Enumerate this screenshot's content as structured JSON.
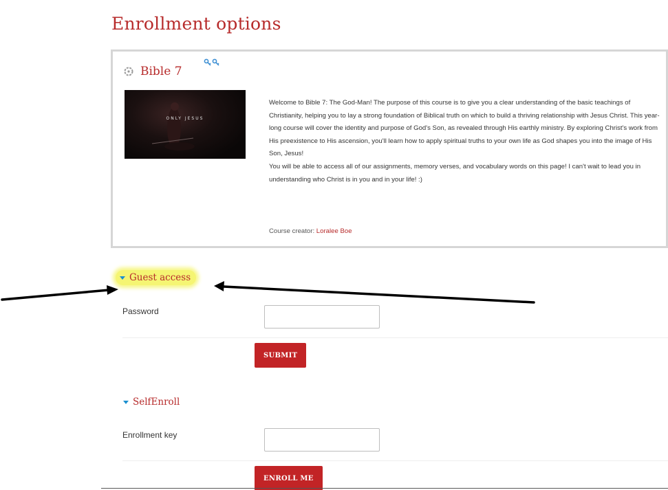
{
  "page": {
    "title": "Enrollment options"
  },
  "course": {
    "name": "Bible 7",
    "image_caption": "ONLY JESUS",
    "summary_paragraph_1": "Welcome to Bible 7: The God-Man!  The purpose of this course is to give you a clear understanding of the basic teachings of Christianity, helping you to lay a strong foundation of Biblical truth on which to build a thriving relationship with Jesus Christ.  This year-long course will cover the identity and purpose of God's Son, as revealed through His earthly ministry. By exploring Christ's work from His preexistence to His ascension, you'll learn how to apply spiritual truths to your own life as God shapes you into the image of His Son, Jesus!",
    "summary_paragraph_2": "You will be able to access all of our assignments, memory verses, and vocabulary words on this page! I can't wait to lead you in understanding who Christ is in you and in your life! :)",
    "creator_label": "Course creator:",
    "creator_name": "Loralee Boe"
  },
  "guest_access": {
    "header": "Guest access",
    "password_label": "Password",
    "password_value": "",
    "submit_label": "SUBMIT"
  },
  "self_enroll": {
    "header": "SelfEnroll",
    "key_label": "Enrollment key",
    "key_value": "",
    "enroll_label": "ENROLL ME"
  },
  "icons": {
    "course": "course-icon",
    "guest": "guest-access-icon",
    "section_toggle": "caret-down-icon"
  },
  "colors": {
    "accent": "#b72b2b",
    "button": "#c22426",
    "caret": "#1a8fcf",
    "highlight": "#f5f573"
  }
}
